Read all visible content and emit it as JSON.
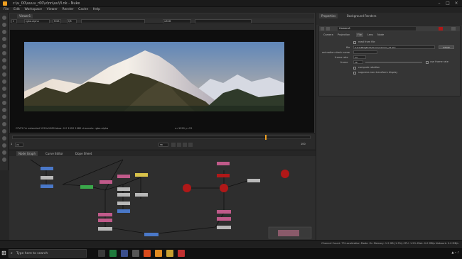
{
  "window": {
    "title": "c:\\u_00\\uuuu_r00\\v\\nn\\uu\\fl.nk - Nuke"
  },
  "menu": [
    "File",
    "Edit",
    "Workspace",
    "Viewer",
    "Render",
    "Cache",
    "Help"
  ],
  "viewer": {
    "tab_label": "Viewer1",
    "channel_field": "rgba.alpha",
    "colorspace_field": "RGB",
    "display_field": "sRGB",
    "gain_label": "f/8",
    "info_line": "CFVFX Vr extended 1920x1080  bbox: 0 0 1920 1080  channels: rgba.alpha",
    "coord_readout": "x=1920 y=22"
  },
  "timeline": {
    "frame_field": "58",
    "fps_field": "24",
    "in_label": "1",
    "out_label": "100"
  },
  "properties": {
    "tabs": [
      "Properties",
      "Background Renders"
    ],
    "node_name": "Camera1",
    "node_tabs": [
      "Camera",
      "Projection",
      "File",
      "Lens",
      "Node"
    ],
    "read_from_file_label": "read from file",
    "file_label": "file",
    "file_path": "E:/FX/PROJECTS/fxcam/camera_01.abc",
    "file_button": "refresh",
    "animation_label": "animation stack name",
    "frame_rate_label": "frame rate",
    "frame_rate_value": "24",
    "frame_label": "frame",
    "frame_value": "26",
    "checkbox_1": "compute rotation",
    "checkbox_2": "suppress non-transform display",
    "fixed_label": "use frame rate"
  },
  "dag": {
    "tabs": [
      "Node Graph",
      "Curve Editor",
      "Dope Sheet"
    ]
  },
  "status": {
    "text": "Channel Count: 73  Localization Mode: On  Memory: 1.9 GB (1.5%)  CPU: 1.2%  Disk: 0.0 MB/s  Network: 0.0 MB/s"
  },
  "taskbar": {
    "search_placeholder": "Type here to search"
  },
  "colors": {
    "accent": "#f0a020",
    "node_red": "#b01818",
    "node_pink": "#c05a8a",
    "node_blue": "#4a78c8",
    "node_green": "#3aa84a",
    "node_gray": "#b8b8b8",
    "node_yellow": "#d8c24a"
  }
}
